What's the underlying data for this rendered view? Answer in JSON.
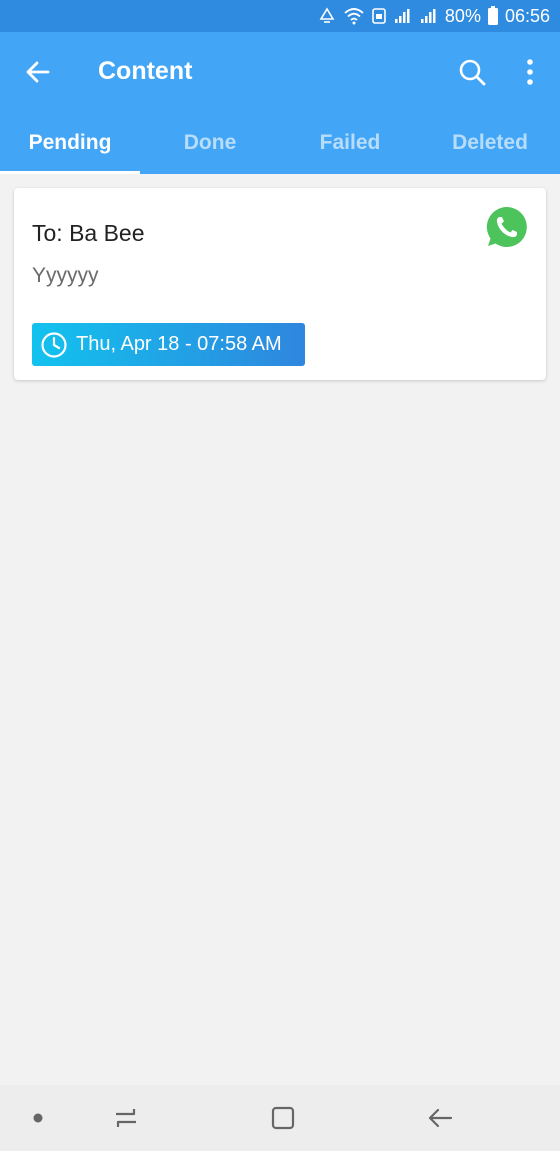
{
  "status_bar": {
    "battery": "80%",
    "time": "06:56"
  },
  "app_bar": {
    "title": "Content",
    "icons": [
      "arrow-back-icon",
      "search-icon",
      "more-vert-icon"
    ]
  },
  "tabs": [
    {
      "label": "Pending",
      "active": true
    },
    {
      "label": "Done",
      "active": false
    },
    {
      "label": "Failed",
      "active": false
    },
    {
      "label": "Deleted",
      "active": false
    }
  ],
  "messages": [
    {
      "to": "To: Ba Bee",
      "body": "Yyyyyy",
      "scheduled": "Thu, Apr 18 - 07:58 AM",
      "app_icon": "whatsapp-icon"
    }
  ],
  "nav_bar": {
    "icons": [
      "dot-icon",
      "recent-apps-icon",
      "home-icon",
      "back-icon"
    ]
  },
  "colors": {
    "app_bar": "#42a5f5",
    "status_bar": "#2f8be0",
    "background": "#f2f2f2",
    "whatsapp": "#4cc35b",
    "chip_start": "#12c2ee",
    "chip_end": "#2f86de"
  }
}
